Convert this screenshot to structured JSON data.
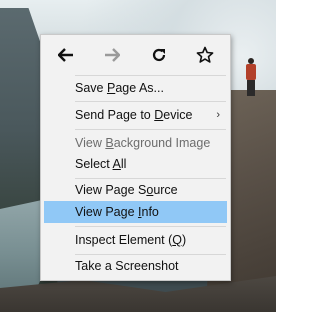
{
  "menu": {
    "nav": {
      "back_icon": "arrow-left-icon",
      "forward_icon": "arrow-right-icon",
      "reload_icon": "reload-icon",
      "bookmark_icon": "star-icon"
    },
    "items": [
      {
        "pre": "Save ",
        "u": "P",
        "post": "age As...",
        "disabled": false
      },
      {
        "pre": "Send Page to ",
        "u": "D",
        "post": "evice",
        "disabled": false,
        "submenu": true
      },
      {
        "pre": "View ",
        "u": "B",
        "post": "ackground Image",
        "disabled": true
      },
      {
        "pre": "Select ",
        "u": "A",
        "post": "ll",
        "disabled": false
      },
      {
        "pre": "View Page S",
        "u": "o",
        "post": "urce",
        "disabled": false
      },
      {
        "pre": "View Page ",
        "u": "I",
        "post": "nfo",
        "disabled": false,
        "highlighted": true
      },
      {
        "pre": "Inspect Element (",
        "u": "Q",
        "post": ")",
        "disabled": false
      },
      {
        "pre": "Take a Screenshot",
        "u": "",
        "post": "",
        "disabled": false
      }
    ],
    "submenu_glyph": "›"
  },
  "colors": {
    "menu_bg": "#f2f2f2",
    "highlight": "#90c8f6",
    "disabled_text": "#6d6d6d"
  }
}
